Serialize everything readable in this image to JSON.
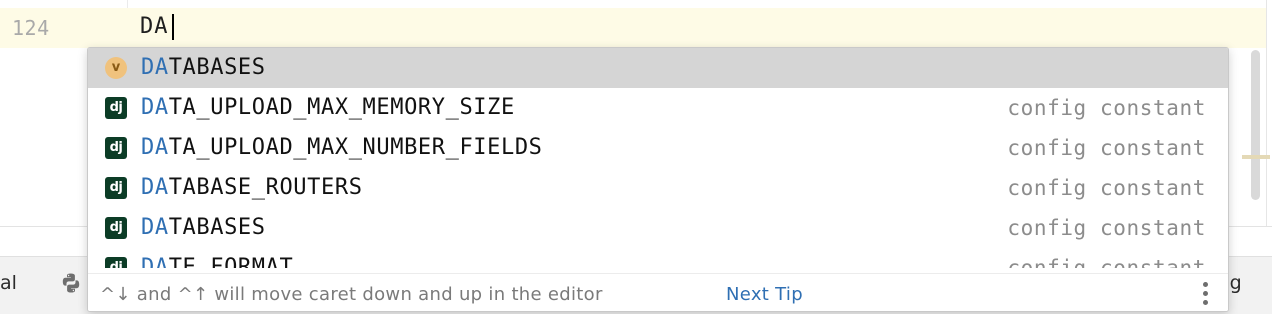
{
  "editor": {
    "line_number": "124",
    "code": "DA"
  },
  "toolbar": {
    "left_text": "al",
    "right_text": "og",
    "python_icon": "python-icon"
  },
  "completion": {
    "items": [
      {
        "match": "DA",
        "rest": "TABASES",
        "type": "",
        "icon": "variable-icon",
        "icon_label": "v",
        "selected": true
      },
      {
        "match": "DA",
        "rest": "TA_UPLOAD_MAX_MEMORY_SIZE",
        "type": "config constant",
        "icon": "django-icon",
        "icon_label": "dj",
        "selected": false
      },
      {
        "match": "DA",
        "rest": "TA_UPLOAD_MAX_NUMBER_FIELDS",
        "type": "config constant",
        "icon": "django-icon",
        "icon_label": "dj",
        "selected": false
      },
      {
        "match": "DA",
        "rest": "TABASE_ROUTERS",
        "type": "config constant",
        "icon": "django-icon",
        "icon_label": "dj",
        "selected": false
      },
      {
        "match": "DA",
        "rest": "TABASES",
        "type": "config constant",
        "icon": "django-icon",
        "icon_label": "dj",
        "selected": false
      },
      {
        "match": "DA",
        "rest": "TE_FORMAT",
        "type": "config constant",
        "icon": "django-icon",
        "icon_label": "dj",
        "selected": false
      }
    ],
    "footer": {
      "hint": "^↓ and ^↑ will move caret down and up in the editor",
      "next_tip": "Next Tip",
      "menu_icon": "more-vertical-icon"
    }
  },
  "colors": {
    "match_highlight": "#2f6fb3",
    "selected_row": "#d5d5d5",
    "django_icon_bg": "#0c3c26",
    "variable_icon_bg": "#f0c27d",
    "current_line_bg": "#fefbe6"
  }
}
